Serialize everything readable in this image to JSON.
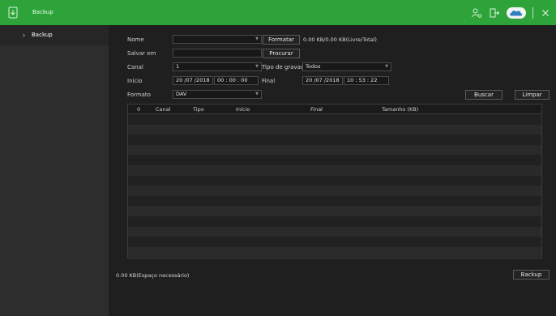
{
  "window": {
    "title": "Backup"
  },
  "sidebar": {
    "items": [
      {
        "label": "Backup"
      }
    ]
  },
  "form": {
    "nome_label": "Nome",
    "nome_value": "",
    "formatar_button": "Formatar",
    "storage_info": "0.00 KB/0.00 KB(Livre/Total)",
    "salvar_em_label": "Salvar em",
    "salvar_em_value": "",
    "procurar_button": "Procurar",
    "canal_label": "Canal",
    "canal_value": "1",
    "tipo_gravacao_label": "Tipo de gravação",
    "tipo_gravacao_value": "Todos",
    "inicio_label": "Início",
    "inicio_date": "20 /07 /2018",
    "inicio_time": "00 : 00 : 00",
    "final_label": "Final",
    "final_date": "20 /07 /2018",
    "final_time": "10 : 53 : 22",
    "formato_label": "Formato",
    "formato_value": "DAV",
    "buscar_button": "Buscar",
    "limpar_button": "Limpar"
  },
  "table": {
    "columns": [
      "0",
      "Canal",
      "Tipo",
      "Início",
      "Final",
      "Tamanho (KB)"
    ],
    "rows": []
  },
  "footer": {
    "space_needed": "0.00 KB(Espaço necessário)",
    "backup_button": "Backup"
  },
  "colors": {
    "accent": "#2ea33a",
    "background": "#1f1f1f",
    "sidebar": "#2d2d2d"
  },
  "icons": [
    "backup-app-icon",
    "user-settings-icon",
    "logout-icon",
    "intelbras-cloud-icon",
    "close-icon"
  ]
}
